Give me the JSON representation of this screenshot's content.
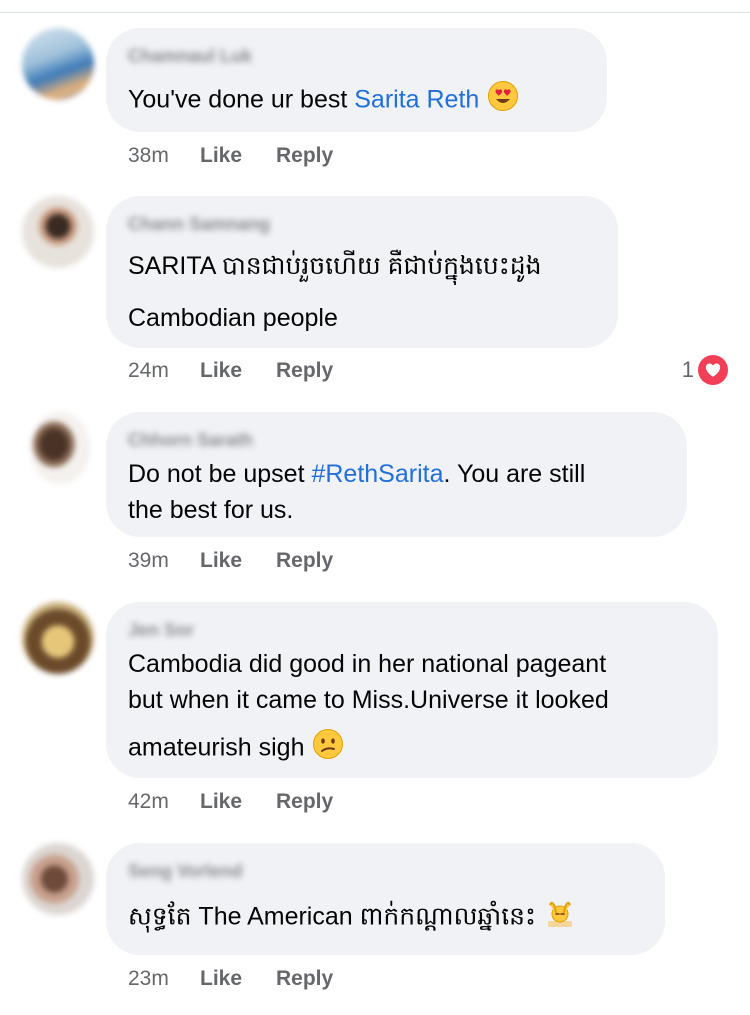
{
  "comments": [
    {
      "author": "Chamnaul Luk",
      "lines": [
        "You've done ur best "
      ],
      "mention": "Sarita Reth",
      "emoji": "heart-eyes-face",
      "time": "38m",
      "like": "Like",
      "reply": "Reply"
    },
    {
      "author": "Chann Samnang",
      "lines": [
        "SARITA បានជាប់រួចហើយ គឺជាប់ក្នុងបេះដូង",
        "Cambodian people"
      ],
      "time": "24m",
      "like": "Like",
      "reply": "Reply",
      "reaction_count": "1",
      "reaction": "heart",
      "colors": {
        "heart": "#f33e58"
      }
    },
    {
      "author": "Chhorn Sarath",
      "line1_before": "Do not be upset ",
      "hashtag": "#RethSarita",
      "line1_after": ". You are still",
      "line2": "the best for us.",
      "time": "39m",
      "like": "Like",
      "reply": "Reply"
    },
    {
      "author": "Jen Sor",
      "lines": [
        "Cambodia did good in her national pageant",
        "but when it came to Miss.Universe it looked",
        "amateurish sigh"
      ],
      "emoji": "confused-face",
      "time": "42m",
      "like": "Like",
      "reply": "Reply"
    },
    {
      "author": "Seng Vorlend",
      "lines": [
        "សុទ្ធតែ The American ពាក់កណ្ដាលឆ្នាំនេះ"
      ],
      "emoji": "person-getting-massage",
      "time": "23m",
      "like": "Like",
      "reply": "Reply"
    }
  ],
  "colors": {
    "link": "#216fdb",
    "bubble": "#f0f2f5",
    "meta": "#65676b"
  }
}
